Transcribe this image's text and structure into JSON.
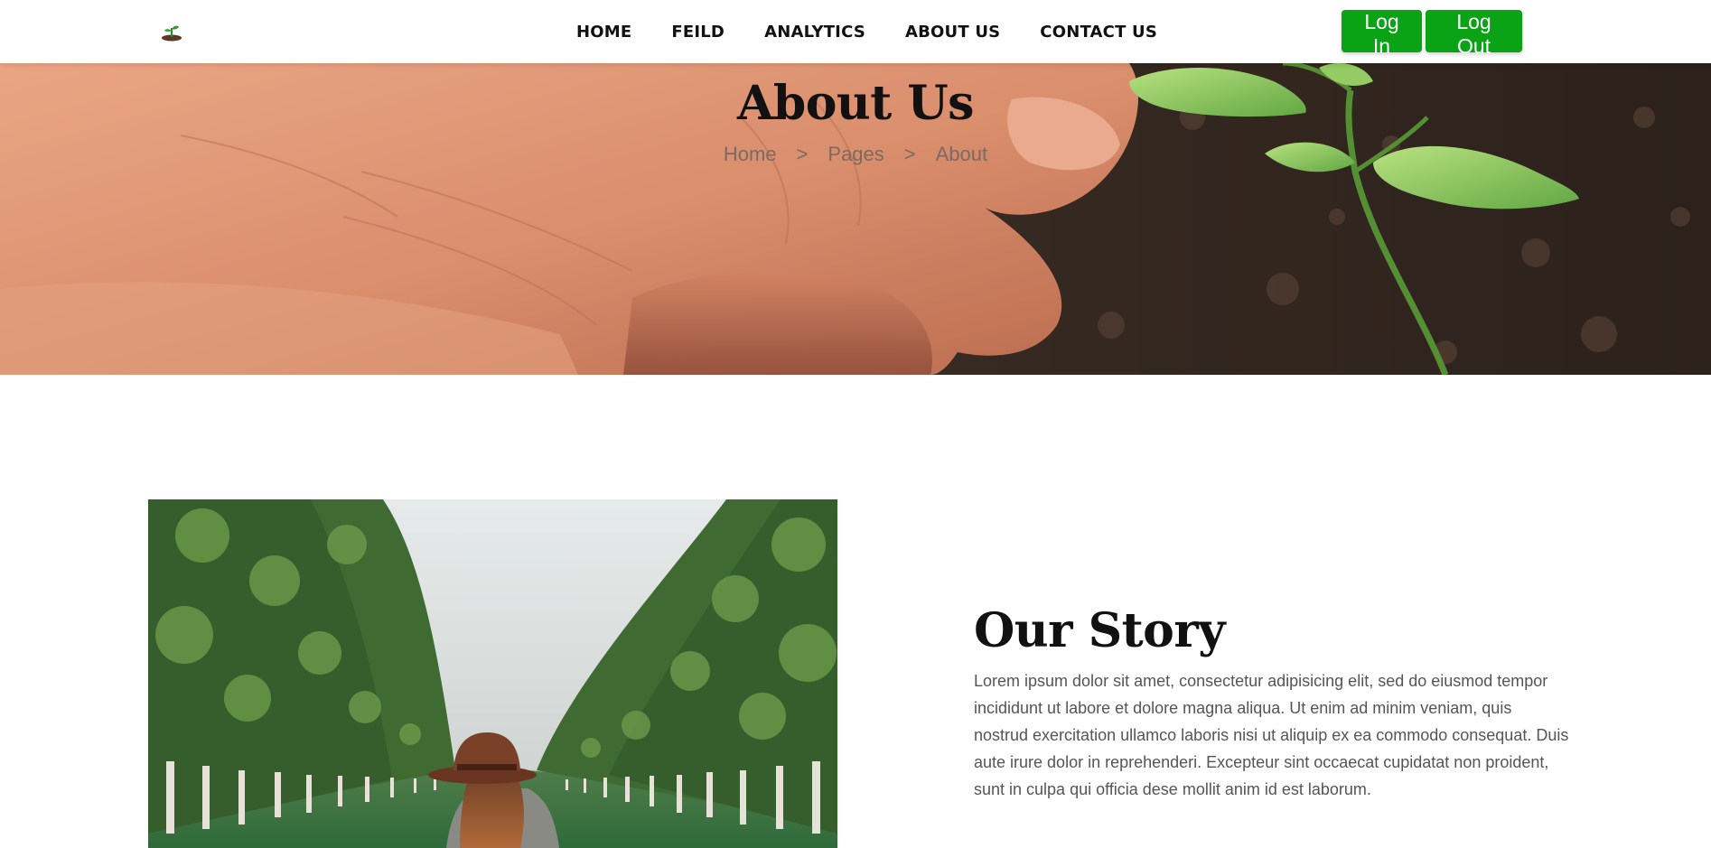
{
  "nav": {
    "items": [
      {
        "label": "HOME"
      },
      {
        "label": "FEILD"
      },
      {
        "label": "ANALYTICS"
      },
      {
        "label": "ABOUT US"
      },
      {
        "label": "CONTACT US"
      }
    ]
  },
  "auth": {
    "login_label": "Log In",
    "logout_label": "Log Out"
  },
  "hero": {
    "title": "About Us",
    "breadcrumb": [
      "Home",
      "Pages",
      "About"
    ],
    "separator": ">"
  },
  "story": {
    "heading": "Our Story",
    "body": "Lorem ipsum dolor sit amet, consectetur adipisicing elit, sed do eiusmod tempor incididunt ut labore et dolore magna aliqua. Ut enim ad minim veniam, quis nostrud exercitation ullamco laboris nisi ut aliquip ex ea commodo consequat. Duis aute irure dolor in reprehenderi. Excepteur sint occaecat cupidatat non proident, sunt in culpa qui officia dese mollit anim id est laborum."
  },
  "colors": {
    "accent": "#0aa316",
    "heading": "#111111",
    "body_text": "#555555"
  },
  "icons": {
    "logo": "sprout-logo-icon"
  }
}
